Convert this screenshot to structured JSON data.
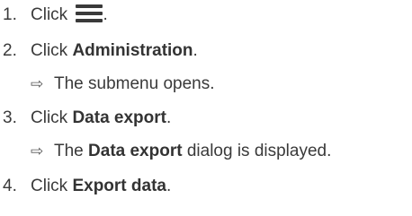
{
  "steps": [
    {
      "number": "1.",
      "prefix": "Click ",
      "icon": "hamburger-menu-icon",
      "suffix": "."
    },
    {
      "number": "2.",
      "prefix": "Click ",
      "bold": "Administration",
      "suffix": "."
    },
    {
      "result_prefix": "The submenu opens.",
      "result_bold": "",
      "result_suffix": ""
    },
    {
      "number": "3.",
      "prefix": "Click ",
      "bold": "Data export",
      "suffix": "."
    },
    {
      "result_prefix": "The ",
      "result_bold": "Data export",
      "result_suffix": " dialog is displayed."
    },
    {
      "number": "4.",
      "prefix": "Click ",
      "bold": "Export data",
      "suffix": "."
    }
  ],
  "result_arrow": "⇨"
}
